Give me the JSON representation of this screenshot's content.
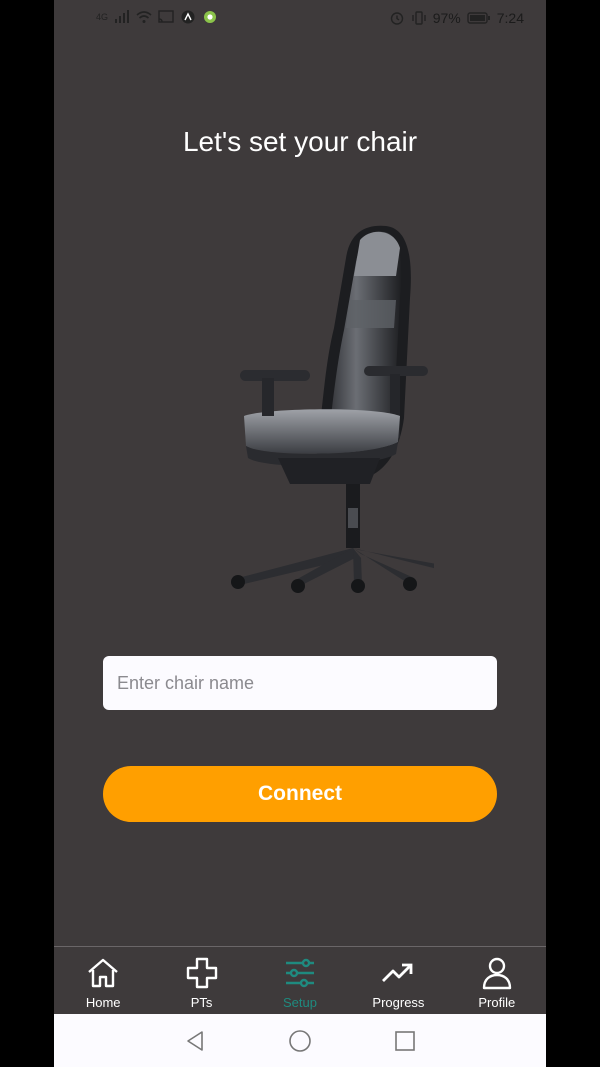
{
  "status_bar": {
    "battery": "97%",
    "time": "7:24",
    "network": "4G"
  },
  "page": {
    "title": "Let's set your chair"
  },
  "form": {
    "chair_name_placeholder": "Enter chair name",
    "chair_name_value": "",
    "connect_label": "Connect"
  },
  "nav": {
    "items": [
      {
        "label": "Home",
        "icon": "home-icon"
      },
      {
        "label": "PTs",
        "icon": "plus-icon"
      },
      {
        "label": "Setup",
        "icon": "sliders-icon",
        "active": true
      },
      {
        "label": "Progress",
        "icon": "trend-icon"
      },
      {
        "label": "Profile",
        "icon": "person-icon"
      }
    ]
  },
  "colors": {
    "background": "#3e3a3b",
    "accent": "#ff9f00",
    "active_tab": "#1f8a7f"
  }
}
